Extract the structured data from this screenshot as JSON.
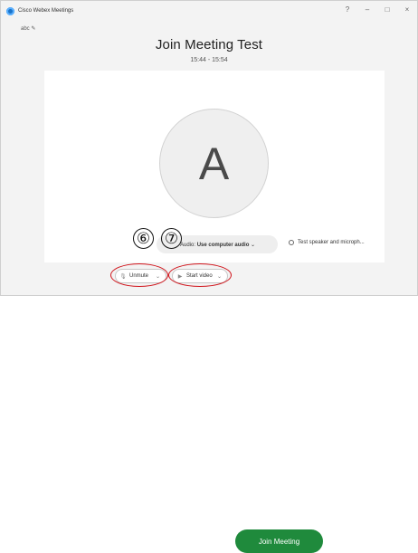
{
  "window": {
    "title": "Cisco Webex Meetings",
    "controls": {
      "help": "?",
      "minimize": "–",
      "maximize": "□",
      "close": "×"
    }
  },
  "topic_edit": {
    "label": "abc",
    "icon": "pencil-icon"
  },
  "meeting": {
    "title": "Join Meeting Test",
    "time_range": "15:44 - 15:54"
  },
  "avatar": {
    "initial": "A"
  },
  "audio": {
    "prefix": "Audio:",
    "selection": "Use computer audio",
    "chevron": "⌄",
    "icon": "audio-icon"
  },
  "test_speaker": {
    "label": "Test speaker and microph...",
    "icon": "speaker-test-icon"
  },
  "annotations": {
    "step6": "⑥",
    "step7": "⑦",
    "accent": "#d0141b"
  },
  "controls": {
    "unmute_label": "Unmute",
    "unmute_chevron": "⌄",
    "start_video_label": "Start video",
    "start_video_chevron": "⌄",
    "join_label": "Join Meeting"
  },
  "colors": {
    "join_green": "#1f8a3c",
    "logo_blue": "#1a73c9"
  }
}
